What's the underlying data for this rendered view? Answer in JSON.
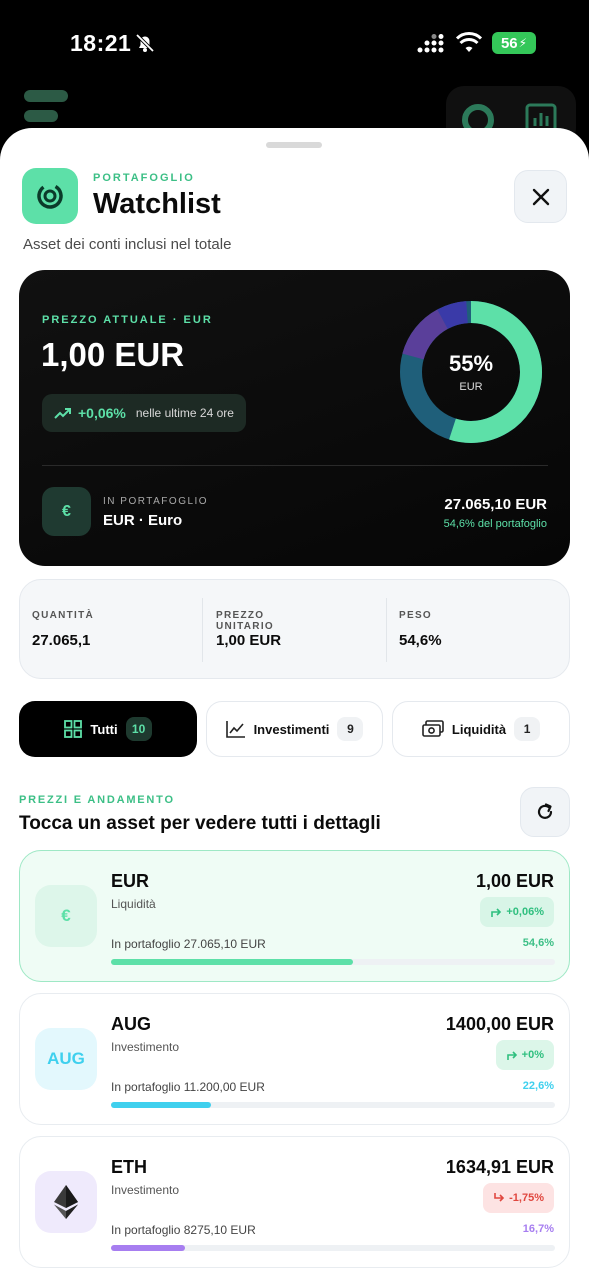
{
  "status": {
    "time": "18:21",
    "battery": "56"
  },
  "header": {
    "kicker": "PORTAFOGLIO",
    "title": "Watchlist",
    "subtitle": "Asset dei conti inclusi nel totale"
  },
  "summary": {
    "kicker": "PREZZO ATTUALE · EUR",
    "price": "1,00 EUR",
    "change": "+0,06%",
    "change_period": "nelle ultime 24 ore",
    "donut_pct": "55%",
    "donut_currency": "EUR",
    "donut_share": 0.55,
    "euro_symbol": "€",
    "in_port_label": "IN PORTAFOGLIO",
    "in_port_value": "EUR · Euro",
    "amount": "27.065,10 EUR",
    "share": "54,6% del portafoglio",
    "accent": "#5de0a8"
  },
  "stats": [
    {
      "label": "QUANTITÀ",
      "value": "27.065,1"
    },
    {
      "label": "PREZZO UNITARIO",
      "value": "1,00 EUR"
    },
    {
      "label": "PESO",
      "value": "54,6%"
    }
  ],
  "tabs": [
    {
      "label": "Tutti",
      "count": "10",
      "icon": "grid-icon"
    },
    {
      "label": "Investimenti",
      "count": "9",
      "icon": "line-chart-icon"
    },
    {
      "label": "Liquidità",
      "count": "1",
      "icon": "cash-icon"
    }
  ],
  "section": {
    "kicker": "PREZZI E ANDAMENTO",
    "title": "Tocca un asset per vedere tutti i dettagli"
  },
  "assets": [
    {
      "symbol": "EUR",
      "logo": "€",
      "type": "Liquidità",
      "price": "1,00 EUR",
      "change": "+0,06%",
      "holding": "In portafoglio 27.065,10 EUR",
      "share": "54,6%",
      "share_fraction": 0.546,
      "color": "#5de0a8"
    },
    {
      "symbol": "AUG",
      "logo": "AUG",
      "type": "Investimento",
      "price": "1400,00 EUR",
      "change": "+0%",
      "holding": "In portafoglio 11.200,00 EUR",
      "share": "22,6%",
      "share_fraction": 0.226,
      "color": "#3fd0ee"
    },
    {
      "symbol": "ETH",
      "logo": "eth-diamond-icon",
      "type": "Investimento",
      "price": "1634,91 EUR",
      "change": "-1,75%",
      "holding": "In portafoglio 8275,10 EUR",
      "share": "16,7%",
      "share_fraction": 0.167,
      "color": "#a77ef0"
    }
  ]
}
